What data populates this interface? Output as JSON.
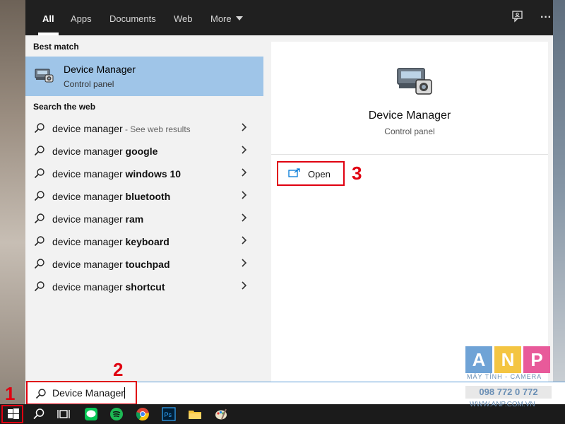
{
  "tabs": [
    {
      "label": "All",
      "active": true
    },
    {
      "label": "Apps"
    },
    {
      "label": "Documents"
    },
    {
      "label": "Web"
    },
    {
      "label": "More"
    }
  ],
  "top_icons": [
    "feedback-icon",
    "more-options-icon"
  ],
  "top_icon_glyphs": {
    "more": "···"
  },
  "best_match": {
    "heading": "Best match",
    "title": "Device Manager",
    "subtitle": "Control panel"
  },
  "web": {
    "heading": "Search the web",
    "items": [
      {
        "prefix": "device manager",
        "bold": "",
        "suffix": " - See web results"
      },
      {
        "prefix": "device manager ",
        "bold": "google",
        "suffix": ""
      },
      {
        "prefix": "device manager ",
        "bold": "windows 10",
        "suffix": ""
      },
      {
        "prefix": "device manager ",
        "bold": "bluetooth",
        "suffix": ""
      },
      {
        "prefix": "device manager ",
        "bold": "ram",
        "suffix": ""
      },
      {
        "prefix": "device manager ",
        "bold": "keyboard",
        "suffix": ""
      },
      {
        "prefix": "device manager ",
        "bold": "touchpad",
        "suffix": ""
      },
      {
        "prefix": "device manager ",
        "bold": "shortcut",
        "suffix": ""
      }
    ]
  },
  "detail": {
    "title": "Device Manager",
    "subtitle": "Control panel",
    "open_label": "Open"
  },
  "search": {
    "value": "Device Manager"
  },
  "steps": [
    "1",
    "2",
    "3"
  ],
  "taskbar_icons": [
    "start-icon",
    "search-icon",
    "task-view-icon",
    "line-icon",
    "spotify-icon",
    "chrome-icon",
    "photoshop-icon",
    "file-explorer-icon",
    "paint-icon"
  ],
  "watermark": {
    "letters": [
      "A",
      "N",
      "P"
    ],
    "tagline": "MÁY TÍNH - CAMERA",
    "phone": "098 772 0 772",
    "website": "WWW.ANP.COM.VN"
  },
  "colors": {
    "accent": "#0078d7",
    "highlight_red": "#e00010",
    "best_match_bg": "#9fc5e8",
    "topbar_bg": "#202020"
  }
}
